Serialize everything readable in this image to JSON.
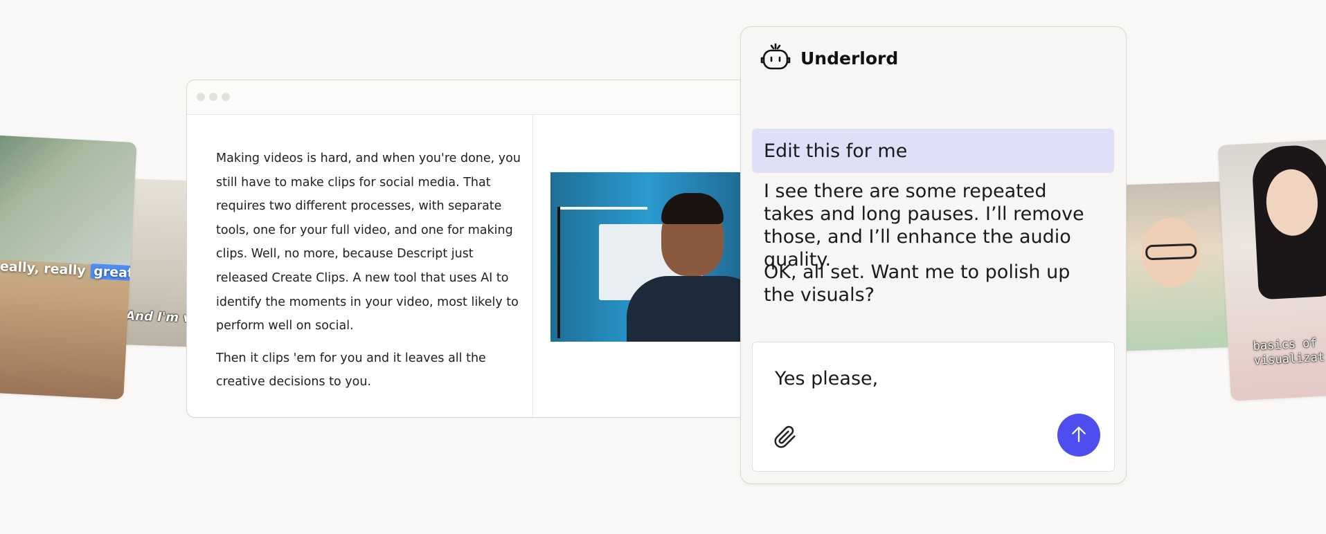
{
  "cards": {
    "left_main_caption_prefix": "eally, really ",
    "left_main_caption_highlight": "great",
    "left_back_caption": "And I'm v",
    "right_main_caption_line1": "basics of",
    "right_main_caption_line2": "visualizat"
  },
  "editor": {
    "transcript": [
      "Making videos is hard, and when you're done, you still have to make clips for social media. That requires two different processes, with separate tools, one for your full video, and one for making clips. Well, no more, because Descript just released Create Clips. A new tool that uses AI to identify the moments in your video, most likely to perform well on social.",
      "Then it clips 'em for you and it leaves all the creative decisions to you."
    ]
  },
  "panel": {
    "title": "Underlord",
    "user_message": "Edit this for me",
    "assistant_messages": [
      "I see there are some repeated takes and long pauses. I’ll remove those, and I’ll enhance the audio quality.",
      "OK, all set. Want me to polish up the visuals?"
    ],
    "composer_value": "Yes please,"
  },
  "colors": {
    "accent": "#4d4df0",
    "user_bubble": "#dfe0f8",
    "background": "#f9f8f6"
  },
  "icons": {
    "logo": "robot-icon",
    "attach": "paperclip-icon",
    "send": "arrow-up-icon"
  }
}
